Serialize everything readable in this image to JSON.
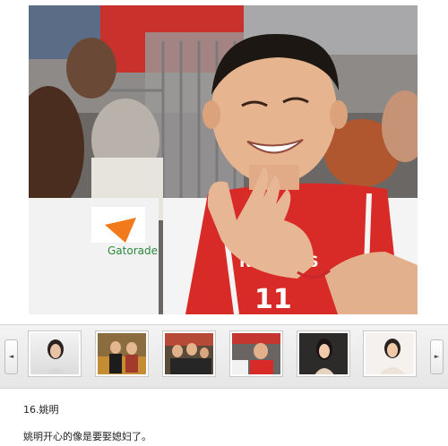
{
  "viewer": {
    "photo_icon": "photo-basketball-player-laughing",
    "jersey_text": "ROCKETS",
    "jersey_number": "11",
    "bench_logo_text": "Gatorade"
  },
  "strip": {
    "prev_label": "◄",
    "next_label": "►",
    "thumbnails": [
      "woman-portrait",
      "couple-seated",
      "group-event",
      "basketball-player",
      "woman-dress",
      "woman-smiling"
    ]
  },
  "caption": {
    "title": "16.姚明",
    "description": "姚明开心的像是要娶媳妇了。"
  }
}
